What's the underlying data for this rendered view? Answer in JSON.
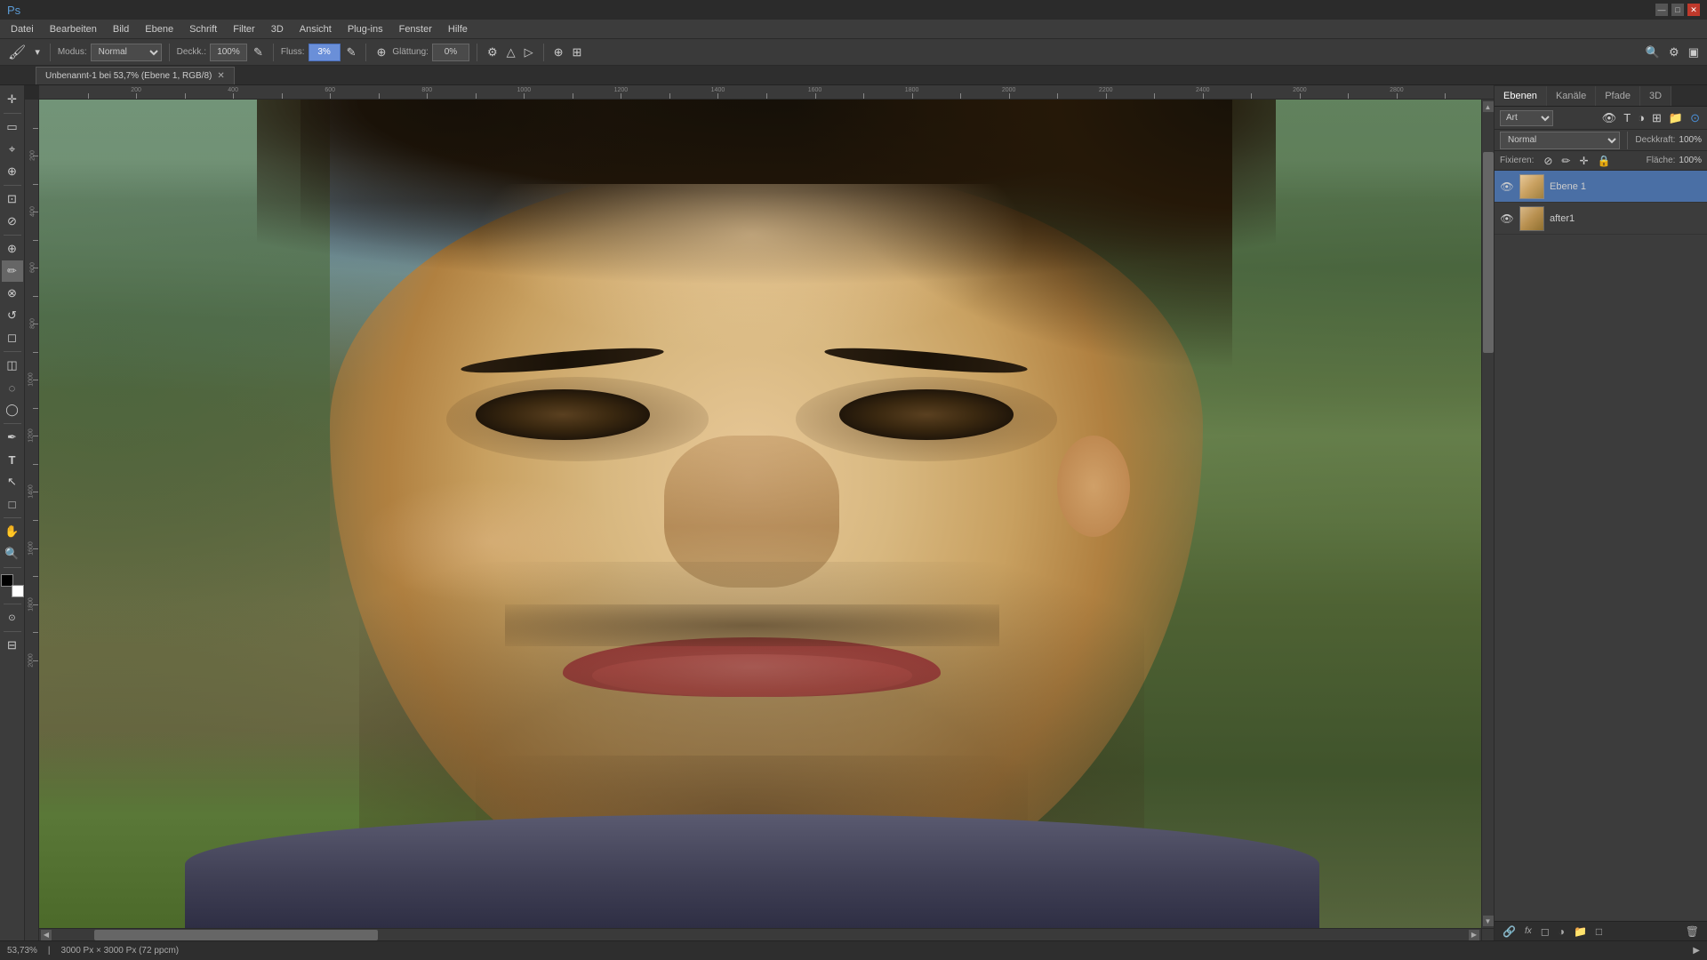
{
  "titleBar": {
    "appName": "Adobe Photoshop",
    "controls": {
      "minimize": "—",
      "maximize": "□",
      "close": "✕"
    }
  },
  "menuBar": {
    "items": [
      "Datei",
      "Bearbeiten",
      "Bild",
      "Ebene",
      "Schrift",
      "Filter",
      "3D",
      "Ansicht",
      "Plug-ins",
      "Fenster",
      "Hilfe"
    ]
  },
  "optionsBar": {
    "brushIcon": "🖌",
    "modeLabel": "Modus:",
    "modeValue": "Normal",
    "opacityLabel": "Deckk.:",
    "opacityValue": "100%",
    "flowLabel": "Fluss:",
    "flowValue": "3%",
    "smoothingLabel": "Glättung:",
    "smoothingValue": "0%"
  },
  "tabBar": {
    "tabs": [
      {
        "title": "Unbenannt-1 bei 53,7% (Ebene 1, RGB/8)",
        "active": true,
        "closeable": true
      }
    ]
  },
  "toolbar": {
    "tools": [
      {
        "name": "move-tool",
        "icon": "✛",
        "active": false
      },
      {
        "name": "select-tool",
        "icon": "▭",
        "active": false
      },
      {
        "name": "lasso-tool",
        "icon": "⌖",
        "active": false
      },
      {
        "name": "quick-select-tool",
        "icon": "⊕",
        "active": false
      },
      {
        "name": "crop-tool",
        "icon": "⊡",
        "active": false
      },
      {
        "name": "eyedropper-tool",
        "icon": "⊘",
        "active": false
      },
      {
        "name": "healing-tool",
        "icon": "⊕",
        "active": false
      },
      {
        "name": "brush-tool",
        "icon": "✏",
        "active": true
      },
      {
        "name": "clone-tool",
        "icon": "⊗",
        "active": false
      },
      {
        "name": "history-brush",
        "icon": "↺",
        "active": false
      },
      {
        "name": "eraser-tool",
        "icon": "◻",
        "active": false
      },
      {
        "name": "gradient-tool",
        "icon": "◫",
        "active": false
      },
      {
        "name": "blur-tool",
        "icon": "◌",
        "active": false
      },
      {
        "name": "dodge-tool",
        "icon": "◯",
        "active": false
      },
      {
        "name": "pen-tool",
        "icon": "✒",
        "active": false
      },
      {
        "name": "text-tool",
        "icon": "T",
        "active": false
      },
      {
        "name": "path-select",
        "icon": "↖",
        "active": false
      },
      {
        "name": "shape-tool",
        "icon": "□",
        "active": false
      },
      {
        "name": "hand-tool",
        "icon": "✋",
        "active": false
      },
      {
        "name": "zoom-tool",
        "icon": "⊕",
        "active": false
      }
    ],
    "fgColor": "#000000",
    "bgColor": "#ffffff"
  },
  "ruler": {
    "ticks": [
      100,
      200,
      300,
      400,
      500,
      600,
      700,
      800,
      900,
      1000,
      1100,
      1200,
      1300,
      1400,
      1500,
      1600,
      1700,
      1800,
      1900,
      2000,
      2100,
      2200,
      2300,
      2400,
      2500,
      2600,
      2700,
      2800,
      2900
    ]
  },
  "rightPanel": {
    "tabs": [
      {
        "label": "Ebenen",
        "active": true
      },
      {
        "label": "Kanäle",
        "active": false
      },
      {
        "label": "Pfade",
        "active": false
      },
      {
        "label": "3D",
        "active": false
      }
    ],
    "searchPlaceholder": "Art",
    "blendMode": "Normal",
    "opacityLabel": "Deckkraft:",
    "opacityValue": "100%",
    "lockLabel": "Fixieren:",
    "flacheLabel": "Fläche:",
    "flacheValue": "100%",
    "layers": [
      {
        "name": "Ebene 1",
        "visible": true,
        "active": true,
        "thumbType": "layer1"
      },
      {
        "name": "after1",
        "visible": true,
        "active": false,
        "thumbType": "layer2"
      }
    ],
    "bottomActions": [
      {
        "name": "link-icon",
        "icon": "🔗"
      },
      {
        "name": "fx-icon",
        "icon": "fx"
      },
      {
        "name": "mask-icon",
        "icon": "◻"
      },
      {
        "name": "adjustment-icon",
        "icon": "◑"
      },
      {
        "name": "group-icon",
        "icon": "📁"
      },
      {
        "name": "new-layer-icon",
        "icon": "□"
      },
      {
        "name": "delete-icon",
        "icon": "🗑"
      }
    ]
  },
  "statusBar": {
    "zoom": "53,73%",
    "dimensions": "3000 Px × 3000 Px (72 ppcm)",
    "statusText": ""
  }
}
